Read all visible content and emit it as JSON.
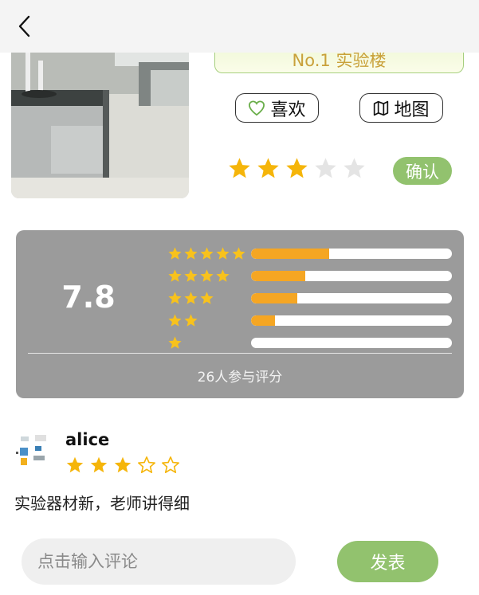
{
  "nav": {
    "back_icon": "chevron-left-icon"
  },
  "lab": {
    "rank_tag": "No.1 实验楼",
    "like_label": "喜欢",
    "map_label": "地图",
    "confirm_label": "确认",
    "user_rating": {
      "filled": 3,
      "max": 5
    }
  },
  "rating": {
    "score": "7.8",
    "participants": "26人参与评分",
    "distribution": [
      {
        "stars": 5,
        "fraction": 0.39
      },
      {
        "stars": 4,
        "fraction": 0.27
      },
      {
        "stars": 3,
        "fraction": 0.23
      },
      {
        "stars": 2,
        "fraction": 0.12
      },
      {
        "stars": 1,
        "fraction": 0.0
      }
    ]
  },
  "review": {
    "username": "alice",
    "stars": {
      "filled": 3,
      "max": 5
    },
    "text": "实验器材新，老师讲得细"
  },
  "comment": {
    "placeholder": "点击输入评论",
    "send_label": "发表"
  },
  "colors": {
    "accent_green": "#92c26e",
    "star_gold": "#f5b50a",
    "bar_orange": "#f5a623",
    "card_gray": "#9b9b9b"
  }
}
